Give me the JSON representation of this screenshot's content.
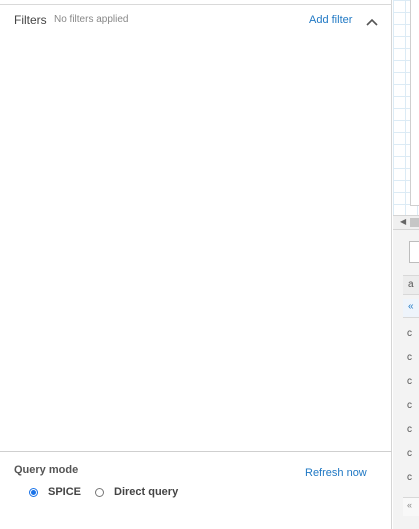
{
  "filters": {
    "title": "Filters",
    "status": "No filters applied",
    "add_label": "Add filter",
    "collapse_icon": "chevron-up-icon"
  },
  "query_mode": {
    "title": "Query mode",
    "refresh_label": "Refresh now",
    "options": [
      {
        "label": "SPICE",
        "selected": true
      },
      {
        "label": "Direct query",
        "selected": false
      }
    ]
  },
  "right_strip": {
    "scroll_left_icon": "chevron-left-icon",
    "header_text": "a",
    "subheader_text": "«",
    "rows": [
      "c",
      "c",
      "c",
      "c",
      "c",
      "c",
      "c"
    ],
    "footer_text": "«"
  },
  "colors": {
    "link": "#1f78c4",
    "radio_selected": "#1a73e8"
  }
}
